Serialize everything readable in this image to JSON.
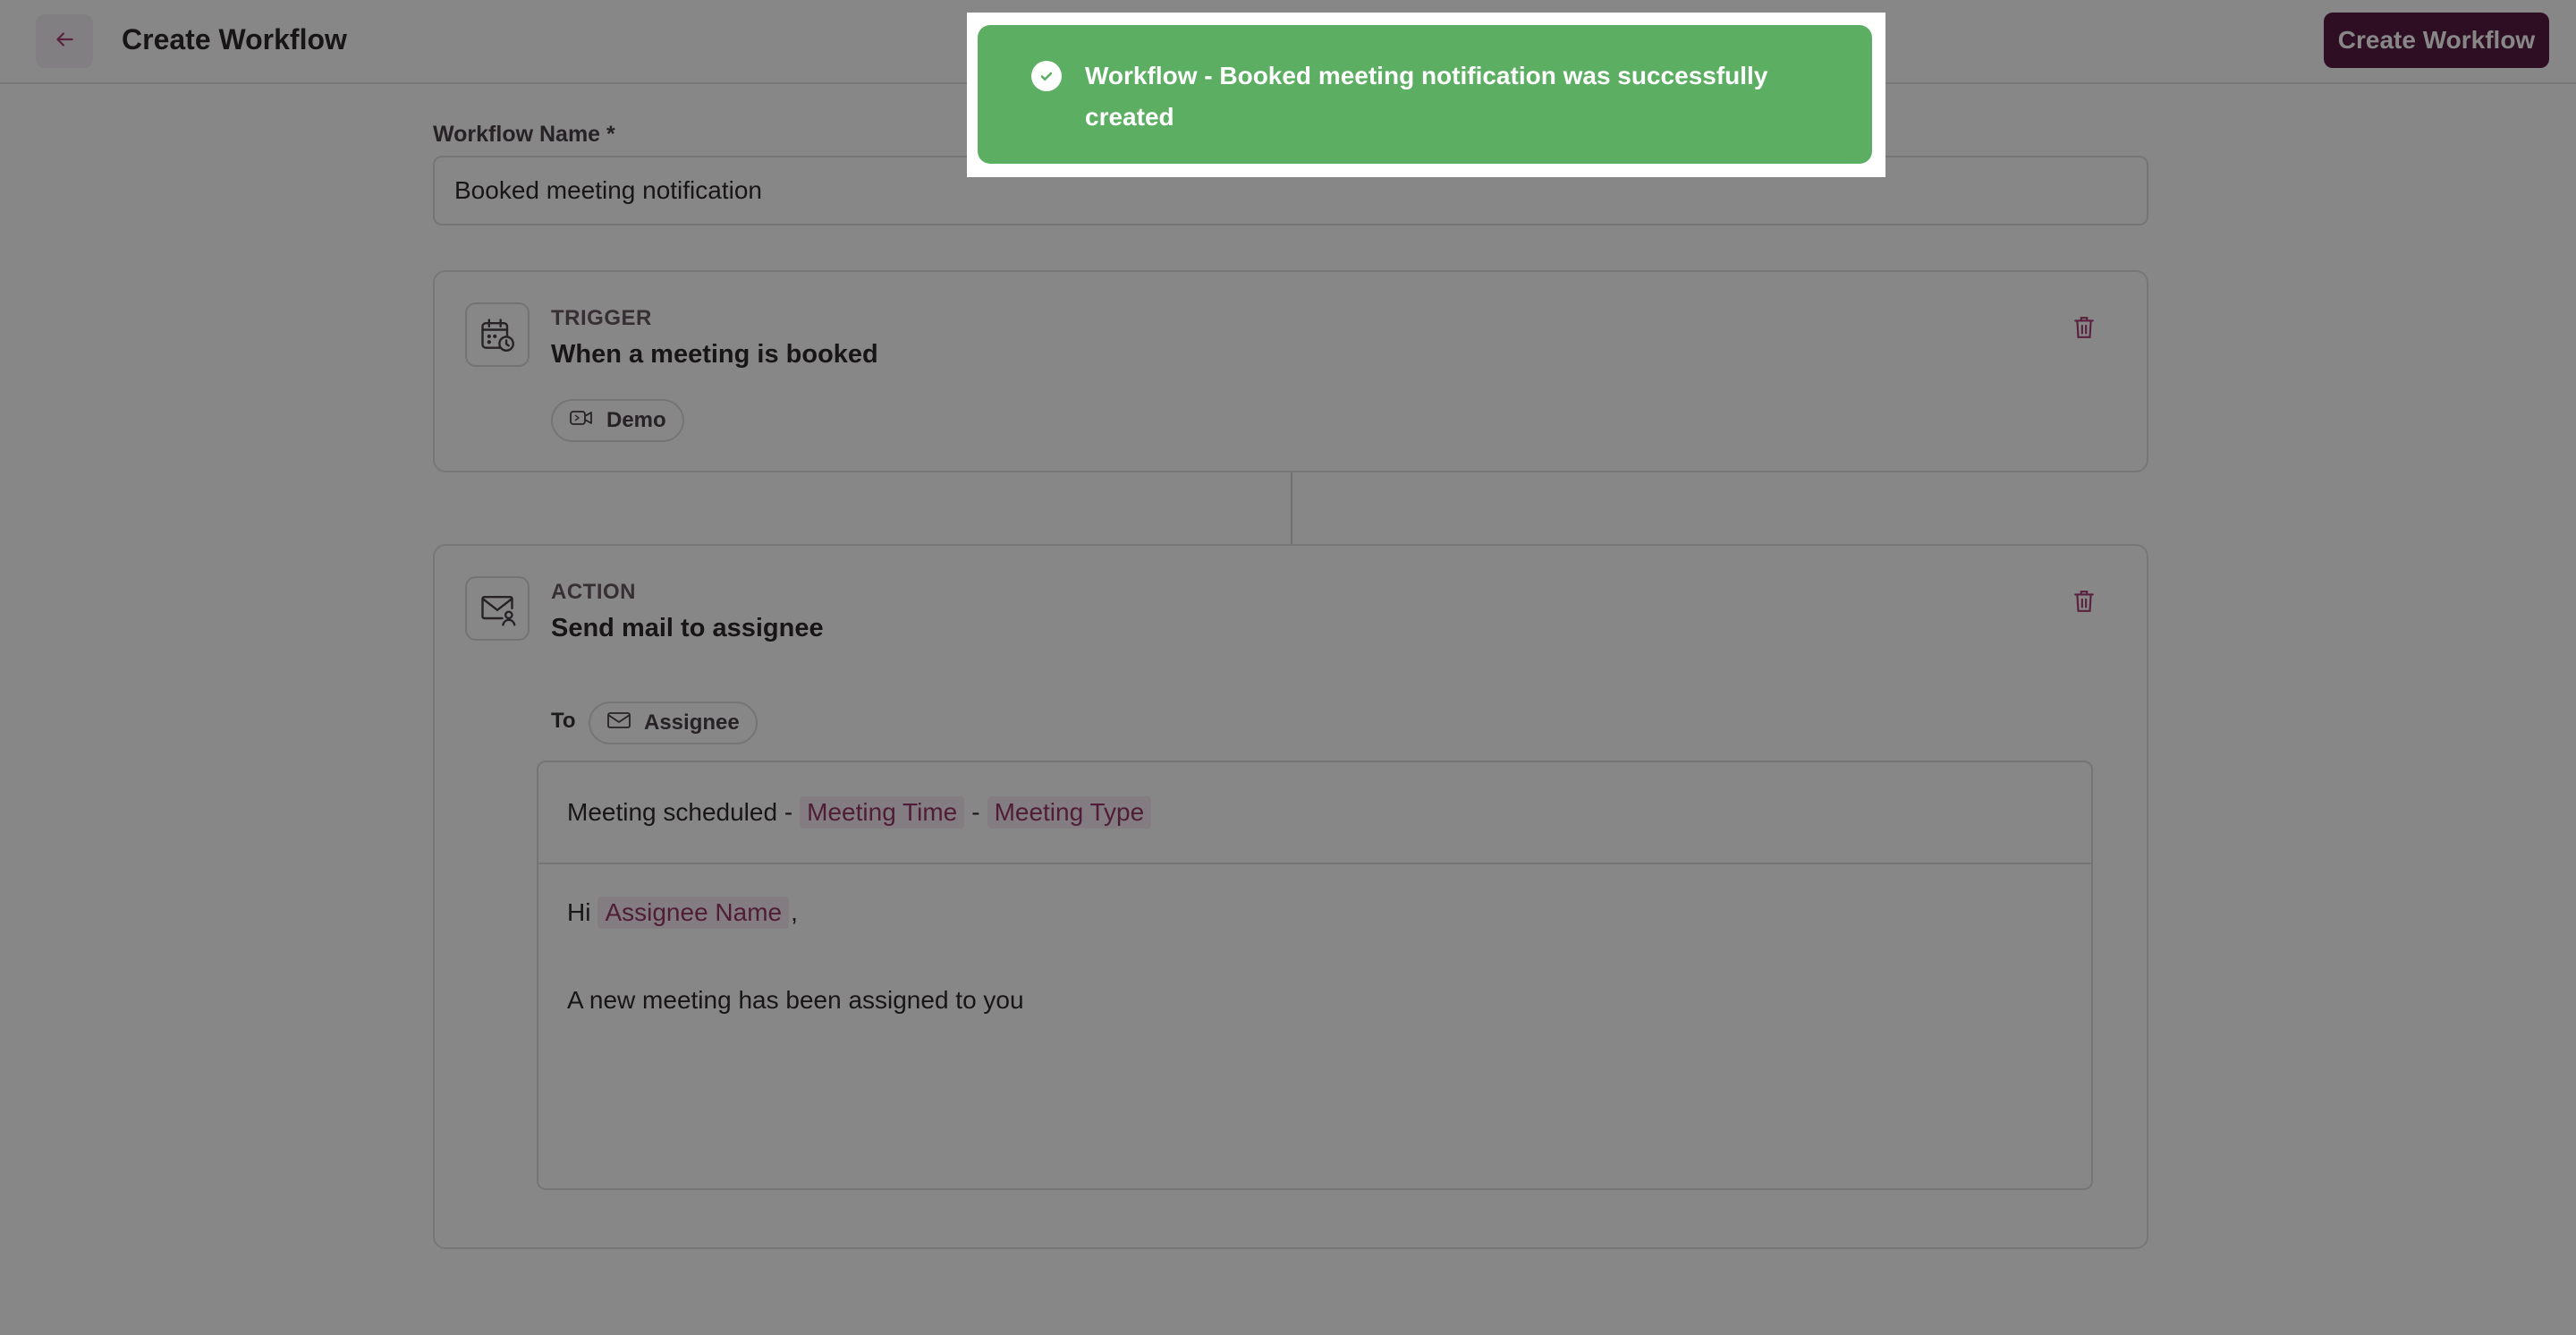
{
  "header": {
    "title": "Create Workflow",
    "primary_button": "Create Workflow",
    "back_icon": "arrow-left-icon"
  },
  "form": {
    "name_label": "Workflow Name *",
    "name_value": "Booked meeting notification"
  },
  "trigger": {
    "kicker": "TRIGGER",
    "title": "When a meeting is booked",
    "icon": "calendar-clock-icon",
    "chip": {
      "icon": "video-icon",
      "label": "Demo"
    }
  },
  "action": {
    "kicker": "ACTION",
    "title": "Send mail to assignee",
    "icon": "mail-user-icon",
    "to_label": "To",
    "recipient": {
      "icon": "mail-icon",
      "label": "Assignee"
    },
    "email": {
      "subject_prefix": "Meeting scheduled -",
      "subject_tag_1": "Meeting Time",
      "subject_separator": "-",
      "subject_tag_2": "Meeting Type",
      "greeting_prefix": "Hi",
      "greeting_tag": "Assignee Name",
      "greeting_suffix": ",",
      "message": "A new meeting has been assigned to you"
    }
  },
  "toast": {
    "message": "Workflow - Booked meeting notification was successfully created",
    "icon": "check-circle-icon",
    "color": "#5cae62"
  },
  "colors": {
    "brand": "#4a0d34",
    "accent": "#a0326a",
    "tag_text": "#8e2a5d",
    "tag_bg": "#f5e9f0"
  }
}
